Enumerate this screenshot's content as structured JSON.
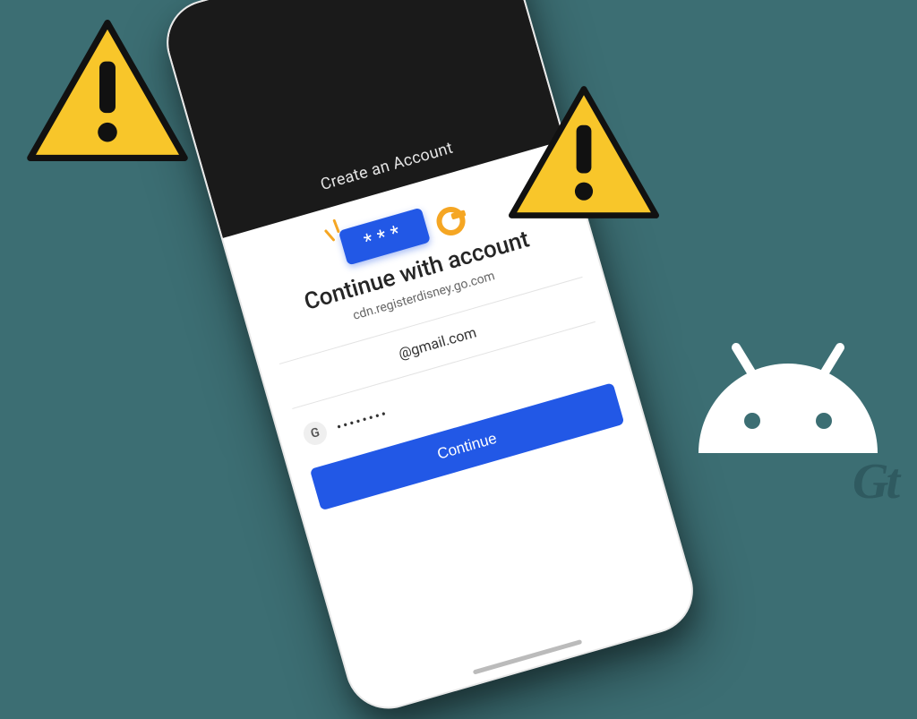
{
  "phone": {
    "header_link": "Create an Account",
    "title": "Continue with account",
    "subtitle": "cdn.registerdisney.go.com",
    "email": "@gmail.com",
    "google_chip": "G",
    "password_dots": "••••••••",
    "continue_label": "Continue",
    "password_badge": "***"
  },
  "branding": {
    "gt_logo": "Gt"
  }
}
